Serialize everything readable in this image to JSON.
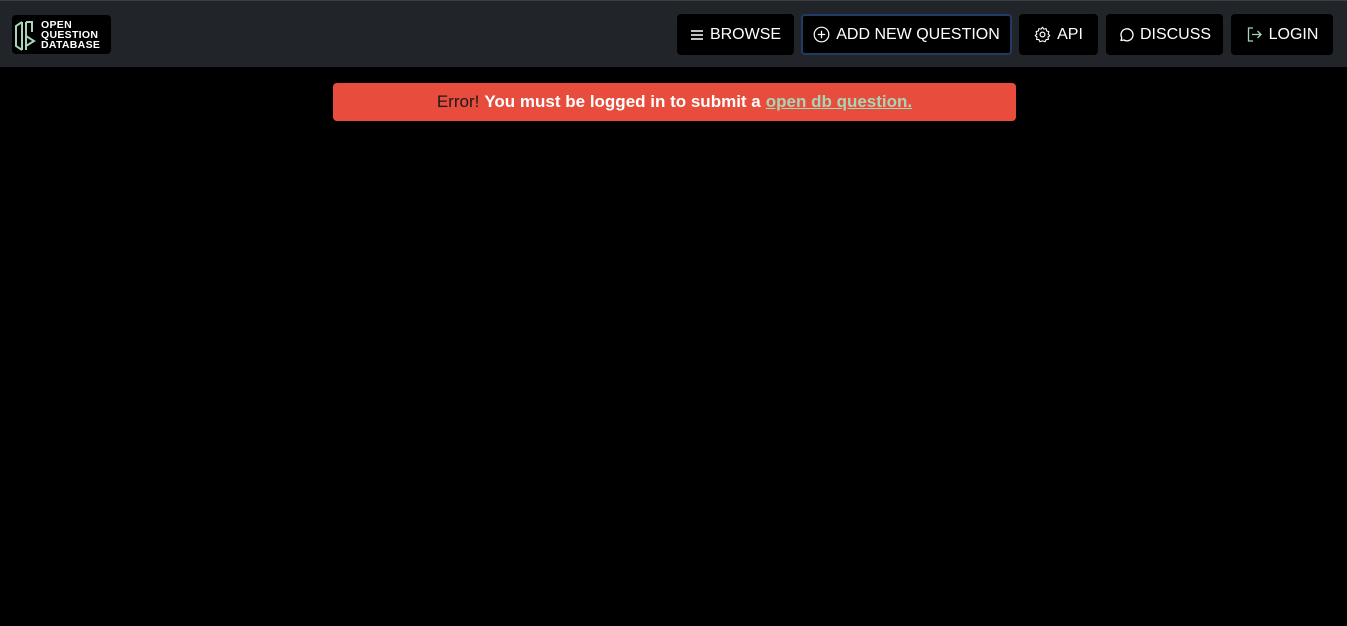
{
  "logo": {
    "lines": [
      "OPEN",
      "QUESTION",
      "DATABASE"
    ],
    "accent": "#a8d5b5"
  },
  "nav": {
    "browse": {
      "label": "BROWSE",
      "icon": "list-icon"
    },
    "add_question": {
      "label": "ADD NEW QUESTION",
      "icon": "plus-circle-icon"
    },
    "api": {
      "label": "API",
      "icon": "gear-icon"
    },
    "discuss": {
      "label": "DISCUSS",
      "icon": "chat-bubble-icon"
    },
    "login": {
      "label": "LOGIN",
      "icon": "login-icon"
    }
  },
  "alert": {
    "prefix": "Error!",
    "message": "You must be logged in to submit a",
    "link_text": "open db question.",
    "color": "#e74c3c"
  }
}
